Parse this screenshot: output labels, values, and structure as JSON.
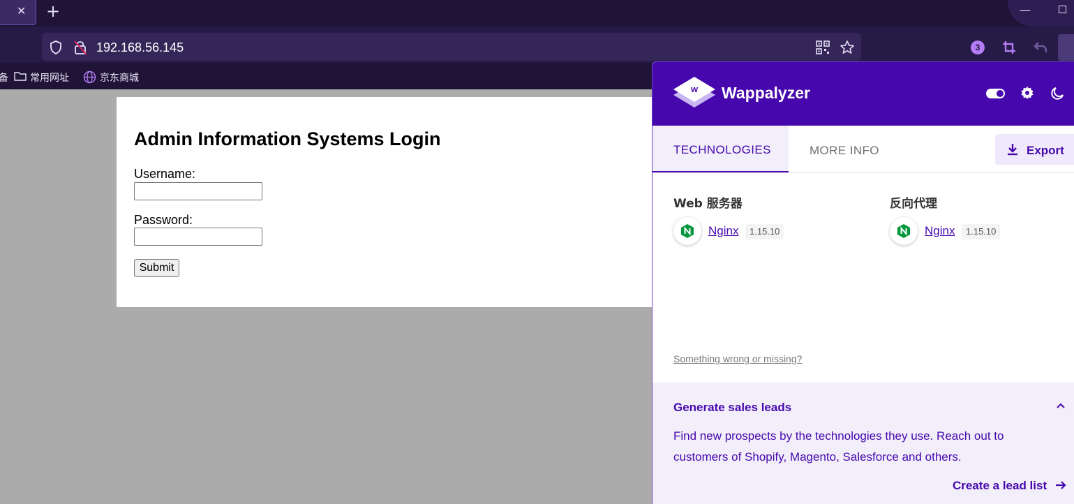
{
  "browser": {
    "tab_close_glyph": "✕",
    "new_tab_glyph": "+",
    "minimize_glyph": "—",
    "url": "192.168.56.145",
    "extension_badge_count": "3",
    "bookmarks": [
      {
        "label": "常用网址",
        "icon": "folder-icon"
      },
      {
        "label": "京东商城",
        "icon": "globe-icon"
      }
    ],
    "bookmark_partial_glyph": "备",
    "accent_color": "#b47cf5"
  },
  "login": {
    "title": "Admin Information Systems Login",
    "username_label": "Username:",
    "username_value": "",
    "password_label": "Password:",
    "password_value": "",
    "submit_label": "Submit"
  },
  "wappalyzer": {
    "brand": "Wappalyzer",
    "brand_color": "#4608ad",
    "tabs": [
      {
        "label": "TECHNOLOGIES",
        "active": true
      },
      {
        "label": "MORE INFO",
        "active": false
      }
    ],
    "export_label": "Export",
    "categories": [
      {
        "title": "Web 服务器",
        "tech": {
          "name": "Nginx",
          "version": "1.15.10",
          "icon": "nginx-icon"
        }
      },
      {
        "title": "反向代理",
        "tech": {
          "name": "Nginx",
          "version": "1.15.10",
          "icon": "nginx-icon"
        }
      }
    ],
    "wrong_link": "Something wrong or missing?",
    "leads": {
      "title": "Generate sales leads",
      "text": "Find new prospects by the technologies they use. Reach out to customers of Shopify, Magento, Salesforce and others.",
      "cta": "Create a lead list"
    }
  }
}
